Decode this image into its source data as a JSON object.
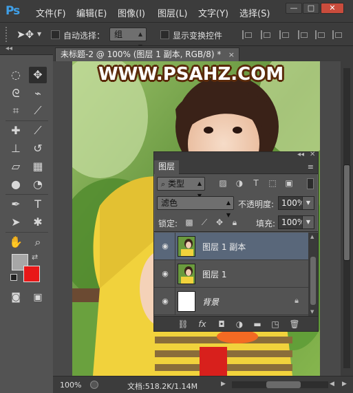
{
  "app": {
    "logo": "Ps",
    "menus": [
      "文件(F)",
      "编辑(E)",
      "图像(I)",
      "图层(L)",
      "文字(Y)",
      "选择(S)"
    ],
    "window_buttons": [
      "—",
      "□",
      "✕"
    ]
  },
  "options_bar": {
    "auto_select_label": "自动选择：",
    "auto_select_value": "组",
    "show_transform_label": "显示变换控件"
  },
  "toolbox": {
    "collapse_label": "◂◂",
    "tools": [
      {
        "name": "marquee-tool",
        "glyph": "◌"
      },
      {
        "name": "move-tool",
        "glyph": "✥"
      },
      {
        "name": "lasso-tool",
        "glyph": "ᘓ"
      },
      {
        "name": "quick-select-tool",
        "glyph": "⌁"
      },
      {
        "name": "crop-tool",
        "glyph": "⌗"
      },
      {
        "name": "eyedropper-tool",
        "glyph": "⟋"
      },
      {
        "name": "healing-brush-tool",
        "glyph": "✚"
      },
      {
        "name": "brush-tool",
        "glyph": "⟋"
      },
      {
        "name": "clone-stamp-tool",
        "glyph": "⊥"
      },
      {
        "name": "history-brush-tool",
        "glyph": "↺"
      },
      {
        "name": "eraser-tool",
        "glyph": "▱"
      },
      {
        "name": "gradient-tool",
        "glyph": "▦"
      },
      {
        "name": "blur-tool",
        "glyph": "●"
      },
      {
        "name": "dodge-tool",
        "glyph": "◔"
      },
      {
        "name": "pen-tool",
        "glyph": "✒"
      },
      {
        "name": "type-tool",
        "glyph": "T"
      },
      {
        "name": "path-select-tool",
        "glyph": "➤"
      },
      {
        "name": "shape-tool",
        "glyph": "✱"
      },
      {
        "name": "hand-tool",
        "glyph": "✋"
      },
      {
        "name": "zoom-tool",
        "glyph": "⌕"
      },
      {
        "name": "quick-mask-tool",
        "glyph": "◙"
      },
      {
        "name": "screen-mode-tool",
        "glyph": "▣"
      }
    ],
    "foreground_color": "#a7a7a7",
    "background_color": "#e81818"
  },
  "document": {
    "tab_title": "未标题-2 @ 100% (图层 1 副本, RGB/8) *",
    "tab_close": "×",
    "watermark": "WWW.PSAHZ.COM",
    "zoom": "100%",
    "doc_size": "文档:518.2K/1.14M"
  },
  "layers_panel": {
    "panel_tab": "图层",
    "filter_kind": "类型",
    "blend_mode": "滤色",
    "opacity_label": "不透明度:",
    "opacity_value": "100%",
    "lock_label": "锁定:",
    "fill_label": "填充:",
    "fill_value": "100%",
    "layers": [
      {
        "name": "图层 1 副本",
        "selected": true,
        "locked": false
      },
      {
        "name": "图层 1",
        "selected": false,
        "locked": false
      },
      {
        "name": "背景",
        "selected": false,
        "locked": true
      }
    ],
    "bottom_icons": [
      "link-layers-icon",
      "fx-icon",
      "add-mask-icon",
      "adjustment-layer-icon",
      "new-group-icon",
      "new-layer-icon",
      "delete-layer-icon"
    ]
  }
}
